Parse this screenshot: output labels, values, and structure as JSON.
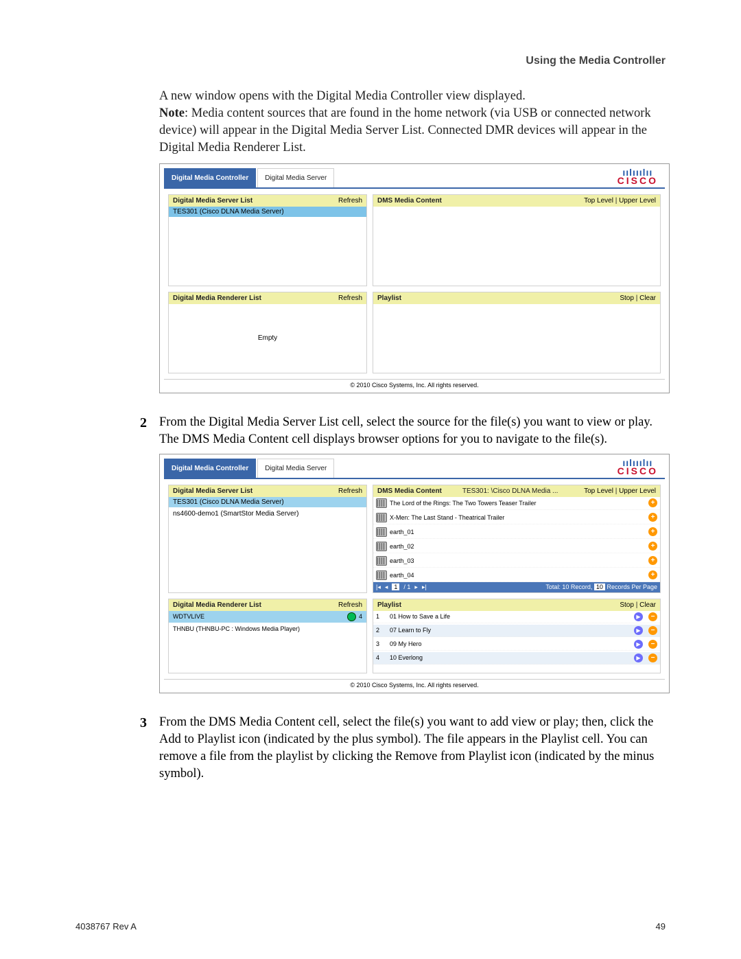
{
  "sectionHeading": "Using the Media Controller",
  "intro": {
    "line1": "A new window opens with the Digital Media Controller view displayed.",
    "noteLabel": "Note",
    "noteBody": ": Media content sources that are found in the home network (via USB or connected network device) will appear in the Digital Media Server List. Connected DMR devices will appear in the Digital Media Renderer List."
  },
  "tabs": {
    "controller": "Digital Media Controller",
    "server": "Digital Media Server"
  },
  "brand": {
    "bars": "ıılııılıı",
    "name": "CISCO"
  },
  "shot1": {
    "dmsListTitle": "Digital Media Server List",
    "refresh": "Refresh",
    "serverRow": "TES301 (Cisco DLNA Media Server)",
    "dmsContentTitle": "DMS Media Content",
    "topLevel": "Top Level",
    "upperLevel": "Upper Level",
    "dmrListTitle": "Digital Media Renderer List",
    "empty": "Empty",
    "playlistTitle": "Playlist",
    "stop": "Stop",
    "clear": "Clear",
    "copyright": "© 2010 Cisco Systems, Inc. All rights reserved."
  },
  "step2": {
    "num": "2",
    "text": "From the Digital Media Server List cell, select the source for the file(s) you want to view or play. The DMS Media Content cell displays browser options for you to navigate to the file(s)."
  },
  "shot2": {
    "servers": [
      "TES301 (Cisco DLNA Media Server)",
      "ns4600-demo1 (SmartStor Media Server)"
    ],
    "dmsPathLabel": "TES301: \\Cisco DLNA Media ...",
    "files": [
      "The Lord of the Rings: The Two Towers Teaser Trailer",
      "X-Men: The Last Stand - Theatrical Trailer",
      "earth_01",
      "earth_02",
      "earth_03",
      "earth_04"
    ],
    "pager": {
      "page": "1",
      "of": "/ 1",
      "total": "Total: 10 Record,",
      "perPage": "10",
      "rppLabel": "Records Per Page"
    },
    "dmr": [
      {
        "name": "WDTVLIVE",
        "playing": true,
        "count": "4"
      },
      {
        "name": "THNBU (THNBU-PC : Windows Media Player)",
        "playing": false,
        "count": ""
      }
    ],
    "playlist": [
      {
        "idx": "1",
        "name": "01 How to Save a Life"
      },
      {
        "idx": "2",
        "name": "07 Learn to Fly"
      },
      {
        "idx": "3",
        "name": "09 My Hero"
      },
      {
        "idx": "4",
        "name": "10 Everlong"
      }
    ]
  },
  "step3": {
    "num": "3",
    "text": "From the DMS Media Content cell, select the file(s) you want to add view or play; then, click the Add to Playlist icon (indicated by the plus symbol). The file appears in the Playlist cell. You can remove a file from the playlist by clicking the Remove from Playlist icon (indicated by the minus symbol)."
  },
  "footer": {
    "rev": "4038767 Rev A",
    "page": "49"
  }
}
